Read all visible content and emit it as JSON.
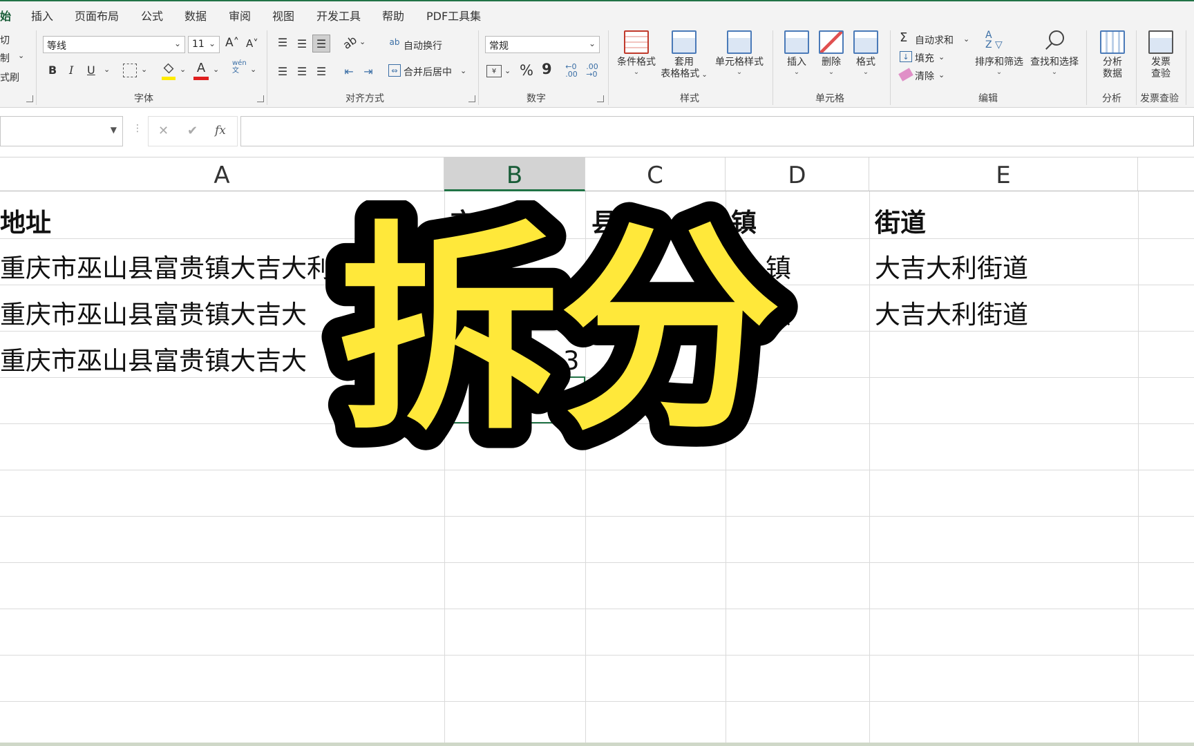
{
  "tabs": [
    "始",
    "插入",
    "页面布局",
    "公式",
    "数据",
    "审阅",
    "视图",
    "开发工具",
    "帮助",
    "PDF工具集"
  ],
  "ribbon": {
    "clipboard": {
      "cut": "切",
      "copy": "制",
      "format_painter": "式刷"
    },
    "font": {
      "name": "等线",
      "size": "11",
      "group_label": "字体",
      "grow": "A˄",
      "shrink": "A˅",
      "bold": "B",
      "italic": "I",
      "underline": "U",
      "phonetic": "wén\n文"
    },
    "alignment": {
      "wrap": "自动换行",
      "merge": "合并后居中",
      "group_label": "对齐方式"
    },
    "number": {
      "format": "常规",
      "group_label": "数字",
      "percent": "%",
      "comma": "9"
    },
    "styles": {
      "conditional": "条件格式",
      "table_line1": "套用",
      "table_line2": "表格格式",
      "cell_styles": "单元格样式",
      "group_label": "样式"
    },
    "cells": {
      "insert": "插入",
      "delete": "删除",
      "format": "格式",
      "group_label": "单元格"
    },
    "editing": {
      "autosum": "自动求和",
      "fill": "填充",
      "clear": "清除",
      "sort_filter": "排序和筛选",
      "find_select": "查找和选择",
      "group_label": "编辑"
    },
    "analysis": {
      "line1": "分析",
      "line2": "数据",
      "group_label": "分析"
    },
    "invoice": {
      "line1": "发票",
      "line2": "查验",
      "group_label": "发票查验"
    }
  },
  "formula_bar": {
    "fx": "fx",
    "cancel": "✕",
    "enter": "✔"
  },
  "columns": [
    "A",
    "B",
    "C",
    "D",
    "E"
  ],
  "rows": [
    {
      "a": "地址",
      "b": "市",
      "c": "县",
      "d": "镇",
      "e": "街道",
      "bold": true
    },
    {
      "a": "重庆市巫山县富贵镇大吉大利街",
      "b": "",
      "c": "",
      "d": "镇",
      "e": "大吉大利街道"
    },
    {
      "a": "重庆市巫山县富贵镇大吉大",
      "b": "",
      "c": "",
      "d": "镇",
      "e": "大吉大利街道"
    },
    {
      "a": "重庆市巫山县富贵镇大吉大",
      "b": "3",
      "c": "",
      "d": "",
      "e": ""
    }
  ],
  "overlay_text": "拆分"
}
